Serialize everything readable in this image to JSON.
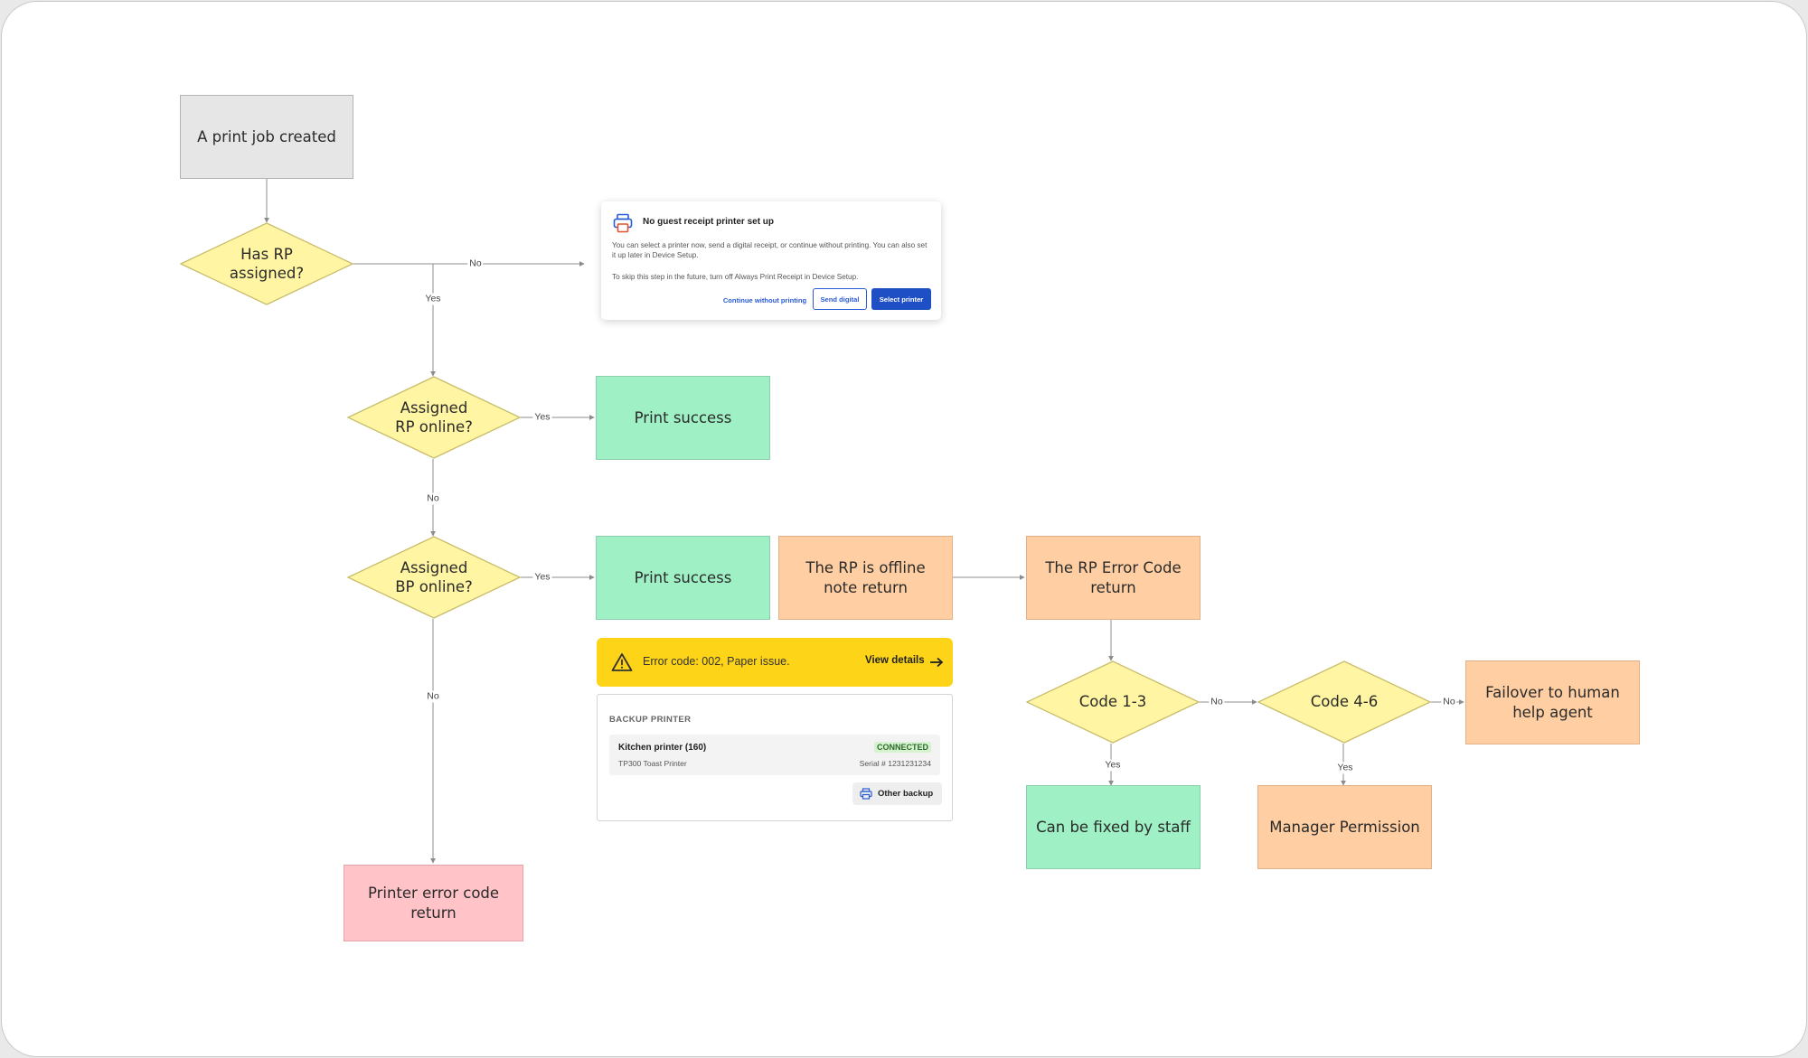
{
  "colors": {
    "decision_fill": "#fff5a3",
    "decision_stroke": "#c8bd6a",
    "start_fill": "#e6e6e6",
    "success_fill": "#9ff0c5",
    "note_fill": "#ffcfa3",
    "error_fill": "#ffc3c8",
    "connector": "#8c8c8c",
    "primary_blue": "#1f4fc4",
    "warning_yellow": "#fdd418"
  },
  "nodes": {
    "start": "A print job created",
    "has_rp": "Has RP assigned?",
    "rp_online": "Assigned RP online?",
    "rp_success": "Print success",
    "bp_online": "Assigned BP online?",
    "bp_success": "Print success",
    "offline_note": "The RP is offline note return",
    "rp_error_code": "The RP Error Code return",
    "code_1_3": "Code 1-3",
    "code_4_6": "Code 4-6",
    "failover": "Failover to human help agent",
    "fixed_by_staff": "Can be fixed by staff",
    "manager_permission": "Manager Permission",
    "printer_error": "Printer error code return"
  },
  "edge_labels": {
    "has_rp_no": "No",
    "has_rp_yes": "Yes",
    "rp_online_yes": "Yes",
    "rp_online_no": "No",
    "bp_online_yes": "Yes",
    "bp_online_no": "No",
    "code13_no": "No",
    "code13_yes": "Yes",
    "code46_no": "No",
    "code46_yes": "Yes"
  },
  "dialog": {
    "icon": "printer-icon",
    "title": "No guest receipt printer set up",
    "body": "You can select a printer now, send a digital receipt, or continue without printing. You can also set it up later in Device Setup.",
    "note": "To skip this step in the future, turn off Always Print Receipt in Device Setup.",
    "continue_label": "Continue without printing",
    "send_digital_label": "Send digital",
    "select_printer_label": "Select printer"
  },
  "error_banner": {
    "icon": "warning-icon",
    "text": "Error code: 002, Paper issue.",
    "link": "View details",
    "arrow_icon": "arrow-right-icon"
  },
  "backup_card": {
    "title": "BACKUP PRINTER",
    "printer_name": "Kitchen printer (160)",
    "printer_model": "TP300 Toast Printer",
    "status": "CONNECTED",
    "serial": "Serial # 1231231234",
    "other_backup_label": "Other backup",
    "other_backup_icon": "printer-icon"
  }
}
